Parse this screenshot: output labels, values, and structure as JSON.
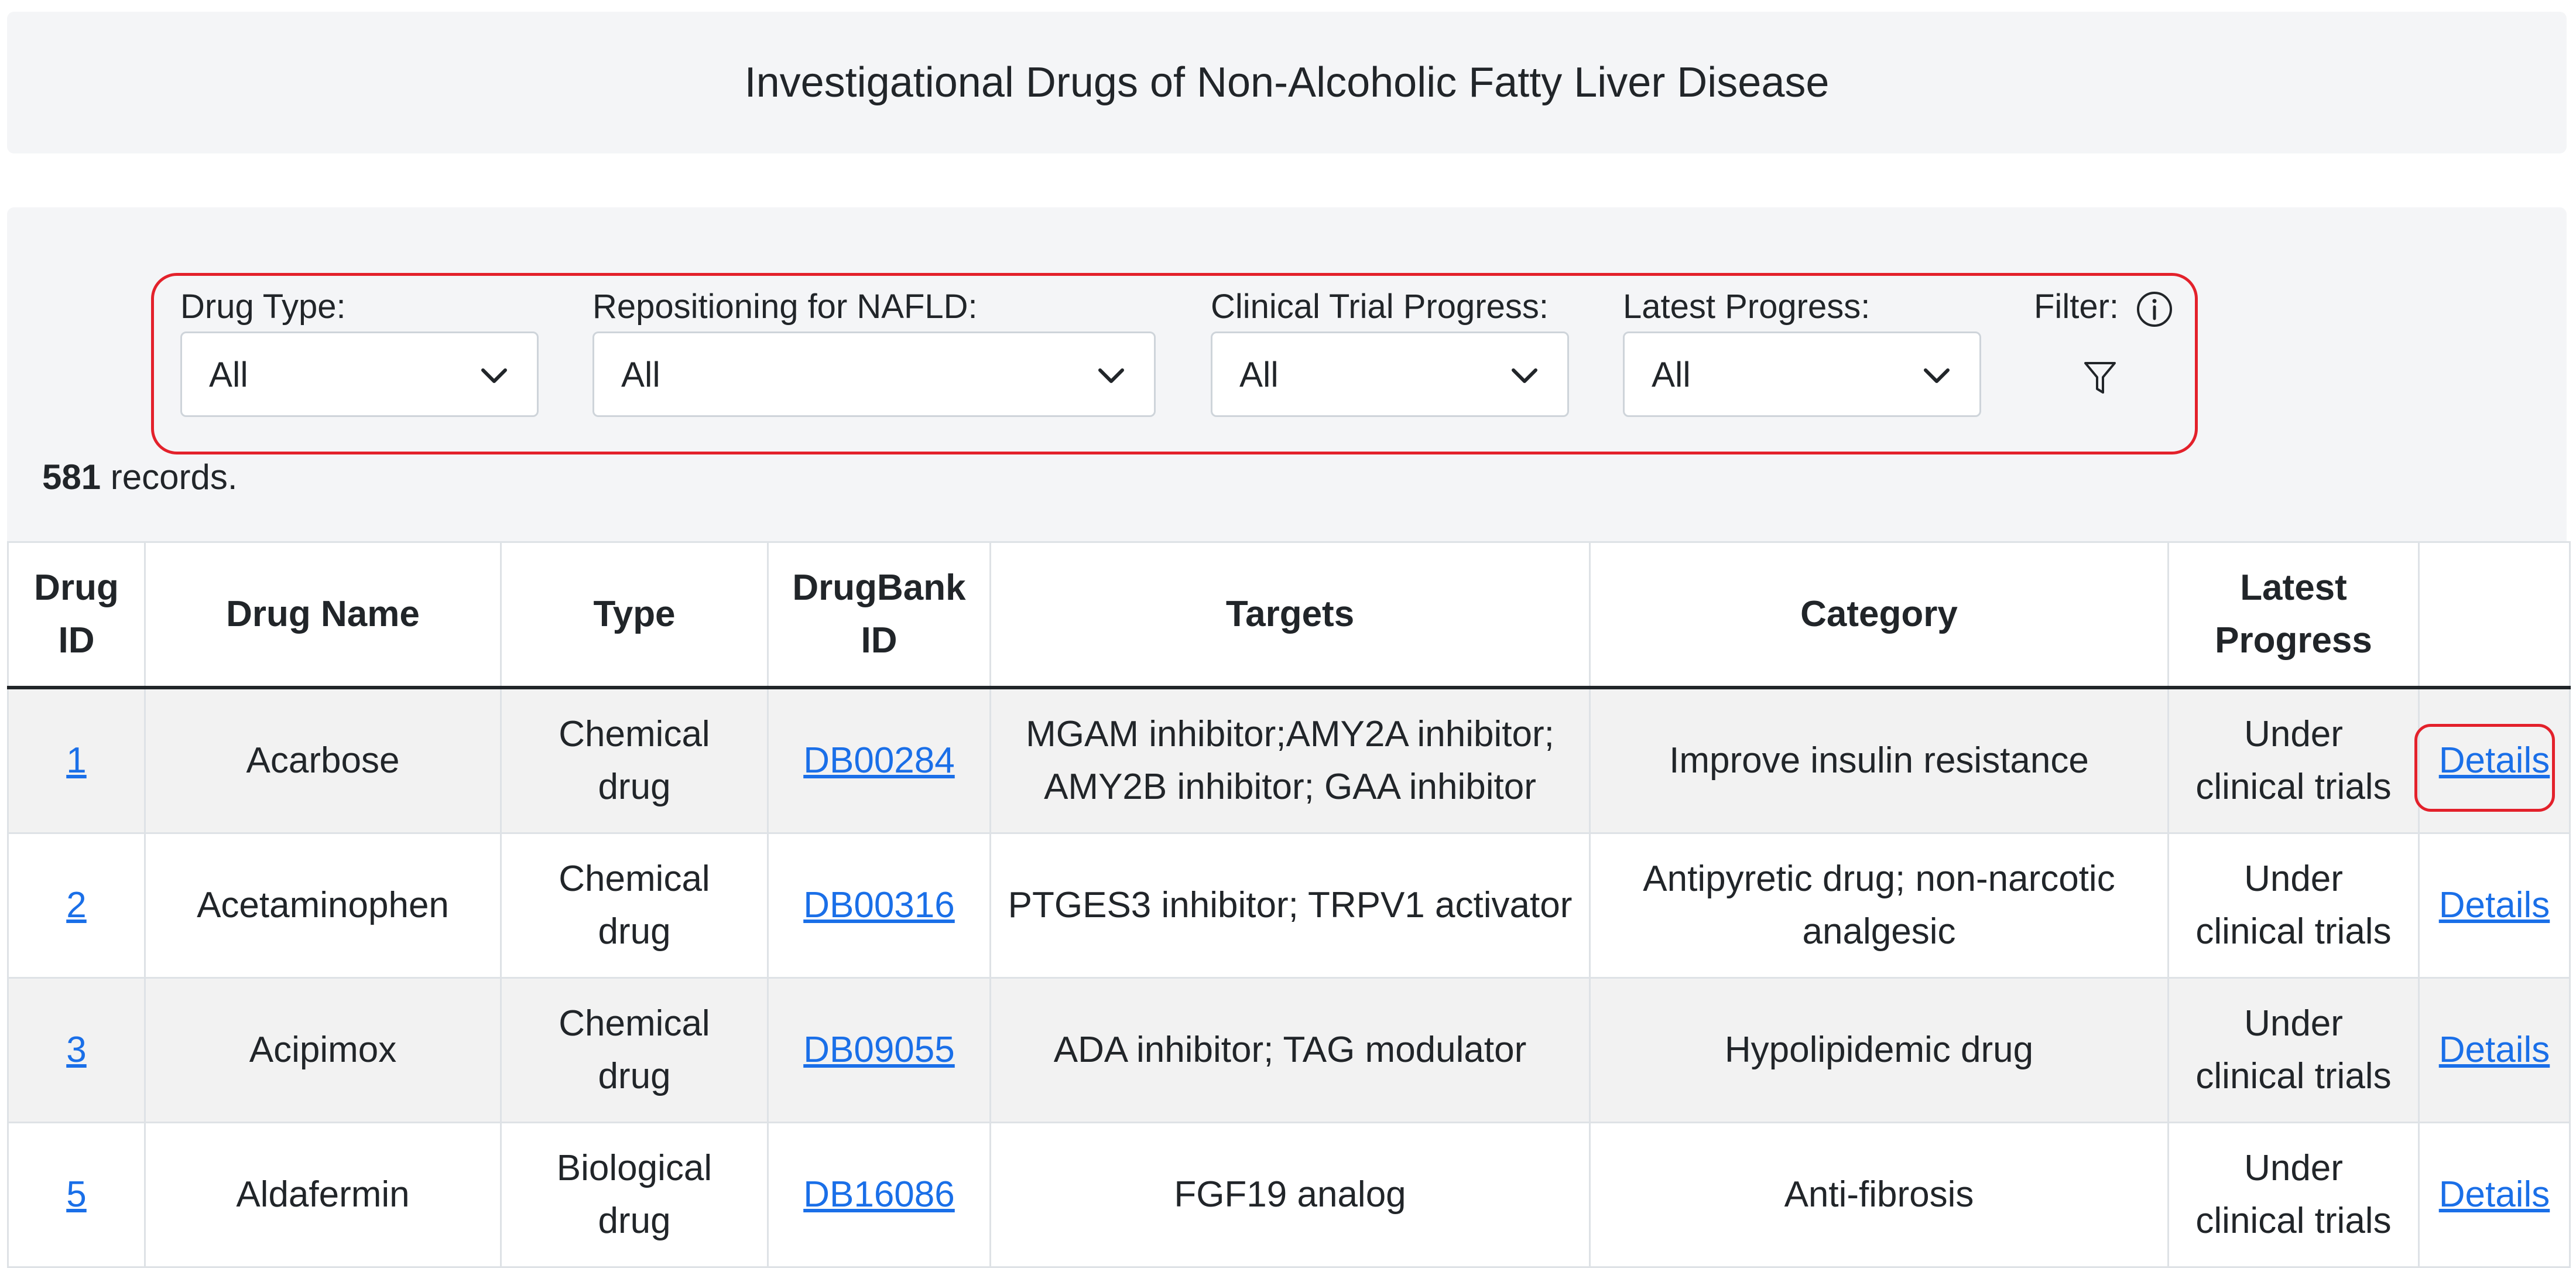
{
  "page": {
    "title": "Investigational Drugs of Non-Alcoholic Fatty Liver Disease"
  },
  "filters": {
    "drug_type": {
      "label": "Drug Type:",
      "value": "All"
    },
    "repositioning": {
      "label": "Repositioning for NAFLD:",
      "value": "All"
    },
    "clinical_trial": {
      "label": "Clinical Trial Progress:",
      "value": "All"
    },
    "latest_progress": {
      "label": "Latest Progress:",
      "value": "All"
    },
    "filter": {
      "label": "Filter:",
      "info_icon": "info-circle-icon",
      "funnel_icon": "funnel-icon"
    }
  },
  "records": {
    "count": "581",
    "suffix": " records."
  },
  "table": {
    "headers": {
      "drug_id_1": "Drug",
      "drug_id_2": "ID",
      "drug_name": "Drug Name",
      "type": "Type",
      "drugbank_1": "DrugBank",
      "drugbank_2": "ID",
      "targets": "Targets",
      "category": "Category",
      "latest_1": "Latest",
      "latest_2": "Progress"
    },
    "rows": [
      {
        "id": "1",
        "name": "Acarbose",
        "type1": "Chemical",
        "type2": "drug",
        "drugbank": "DB00284",
        "targets1": "MGAM inhibitor;AMY2A inhibitor;",
        "targets2": "AMY2B inhibitor; GAA inhibitor",
        "category1": "Improve insulin resistance",
        "category2": "",
        "progress1": "Under",
        "progress2": "clinical trials",
        "details": "Details"
      },
      {
        "id": "2",
        "name": "Acetaminophen",
        "type1": "Chemical",
        "type2": "drug",
        "drugbank": "DB00316",
        "targets1": "PTGES3 inhibitor; TRPV1 activator",
        "targets2": "",
        "category1": "Antipyretic drug; non-narcotic",
        "category2": "analgesic",
        "progress1": "Under",
        "progress2": "clinical trials",
        "details": "Details"
      },
      {
        "id": "3",
        "name": "Acipimox",
        "type1": "Chemical",
        "type2": "drug",
        "drugbank": "DB09055",
        "targets1": "ADA inhibitor; TAG modulator",
        "targets2": "",
        "category1": "Hypolipidemic drug",
        "category2": "",
        "progress1": "Under",
        "progress2": "clinical trials",
        "details": "Details"
      },
      {
        "id": "5",
        "name": "Aldafermin",
        "type1": "Biological",
        "type2": "drug",
        "drugbank": "DB16086",
        "targets1": "FGF19 analog",
        "targets2": "",
        "category1": "Anti-fibrosis",
        "category2": "",
        "progress1": "Under",
        "progress2": "clinical trials",
        "details": "Details"
      }
    ]
  },
  "colors": {
    "highlight": "#e3212b",
    "link": "#1a6fe8",
    "panel": "#f4f5f7"
  }
}
